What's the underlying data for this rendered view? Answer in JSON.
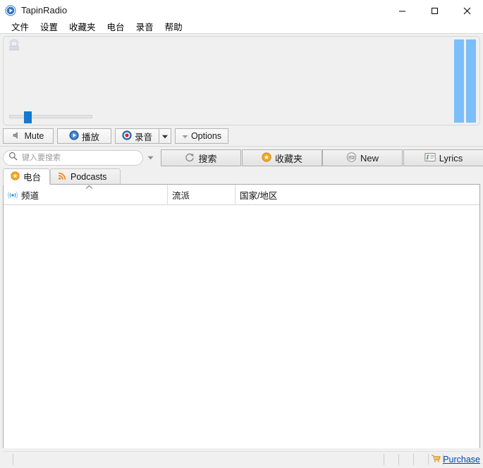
{
  "window": {
    "title": "TapinRadio",
    "app_icon": "play-circle-icon",
    "controls": {
      "minimize": "minimize-icon",
      "maximize": "maximize-icon",
      "close": "close-icon"
    }
  },
  "menubar": {
    "items": [
      {
        "label": "文件"
      },
      {
        "label": "设置"
      },
      {
        "label": "收藏夹"
      },
      {
        "label": "电台"
      },
      {
        "label": "录音"
      },
      {
        "label": "帮助"
      }
    ]
  },
  "visualizer": {
    "icon": "radio-icon",
    "vu_bars": [
      {
        "level": 100,
        "color": "#7cbefa"
      },
      {
        "level": 100,
        "color": "#7cbefa"
      }
    ],
    "volume": {
      "value": 17,
      "min": 0,
      "max": 100
    }
  },
  "transport": {
    "mute": {
      "label": "Mute",
      "icon": "speaker-icon"
    },
    "play": {
      "label": "播放",
      "icon": "play-icon"
    },
    "record": {
      "label": "录音",
      "icon": "record-icon"
    },
    "record_dropdown": {
      "icon": "chevron-down-icon"
    },
    "options": {
      "label": "Options",
      "icon": "chevron-down-icon"
    }
  },
  "search": {
    "placeholder": "键入要搜索",
    "value": "",
    "icon": "search-icon",
    "dropdown_icon": "chevron-down-icon",
    "buttons": {
      "search": {
        "label": "搜索",
        "icon": "search-refresh-icon"
      },
      "favorites": {
        "label": "收藏夹",
        "icon": "star-icon"
      },
      "new": {
        "label": "New",
        "icon": "radio-new-icon"
      },
      "lyrics": {
        "label": "Lyrics",
        "icon": "lyrics-icon"
      }
    }
  },
  "tabs": [
    {
      "label": "电台",
      "icon": "star-icon",
      "active": true
    },
    {
      "label": "Podcasts",
      "icon": "rss-icon",
      "active": false
    }
  ],
  "list": {
    "columns": [
      {
        "label": "频道",
        "icon": "broadcast-icon",
        "sort": "asc"
      },
      {
        "label": "流派",
        "icon": "",
        "sort": ""
      },
      {
        "label": "国家/地区",
        "icon": "",
        "sort": ""
      }
    ],
    "rows": []
  },
  "statusbar": {
    "panels": [
      "",
      "",
      "",
      "",
      "",
      ""
    ],
    "purchase": {
      "label": "Purchase",
      "icon": "cart-icon"
    }
  },
  "colors": {
    "accent": "#1479d2",
    "vu_bar": "#7cbefa",
    "link": "#0645ad",
    "window_bg": "#f0f0f0",
    "panel_bg": "#ffffff"
  }
}
